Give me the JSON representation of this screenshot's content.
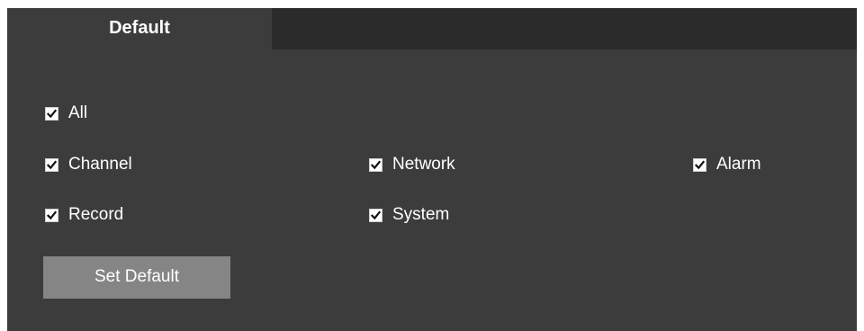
{
  "tabs": [
    {
      "label": "Default",
      "active": true
    }
  ],
  "options": {
    "all": {
      "label": "All",
      "checked": true
    },
    "channel": {
      "label": "Channel",
      "checked": true
    },
    "network": {
      "label": "Network",
      "checked": true
    },
    "alarm": {
      "label": "Alarm",
      "checked": true
    },
    "record": {
      "label": "Record",
      "checked": true
    },
    "system": {
      "label": "System",
      "checked": true
    }
  },
  "actions": {
    "set_default_label": "Set Default"
  },
  "colors": {
    "panel_bg": "#3c3c3c",
    "tab_bar_bg": "#2b2b2b",
    "button_bg": "#858585",
    "text": "#ffffff"
  },
  "icons": {
    "checkbox": "checkmark-icon"
  }
}
